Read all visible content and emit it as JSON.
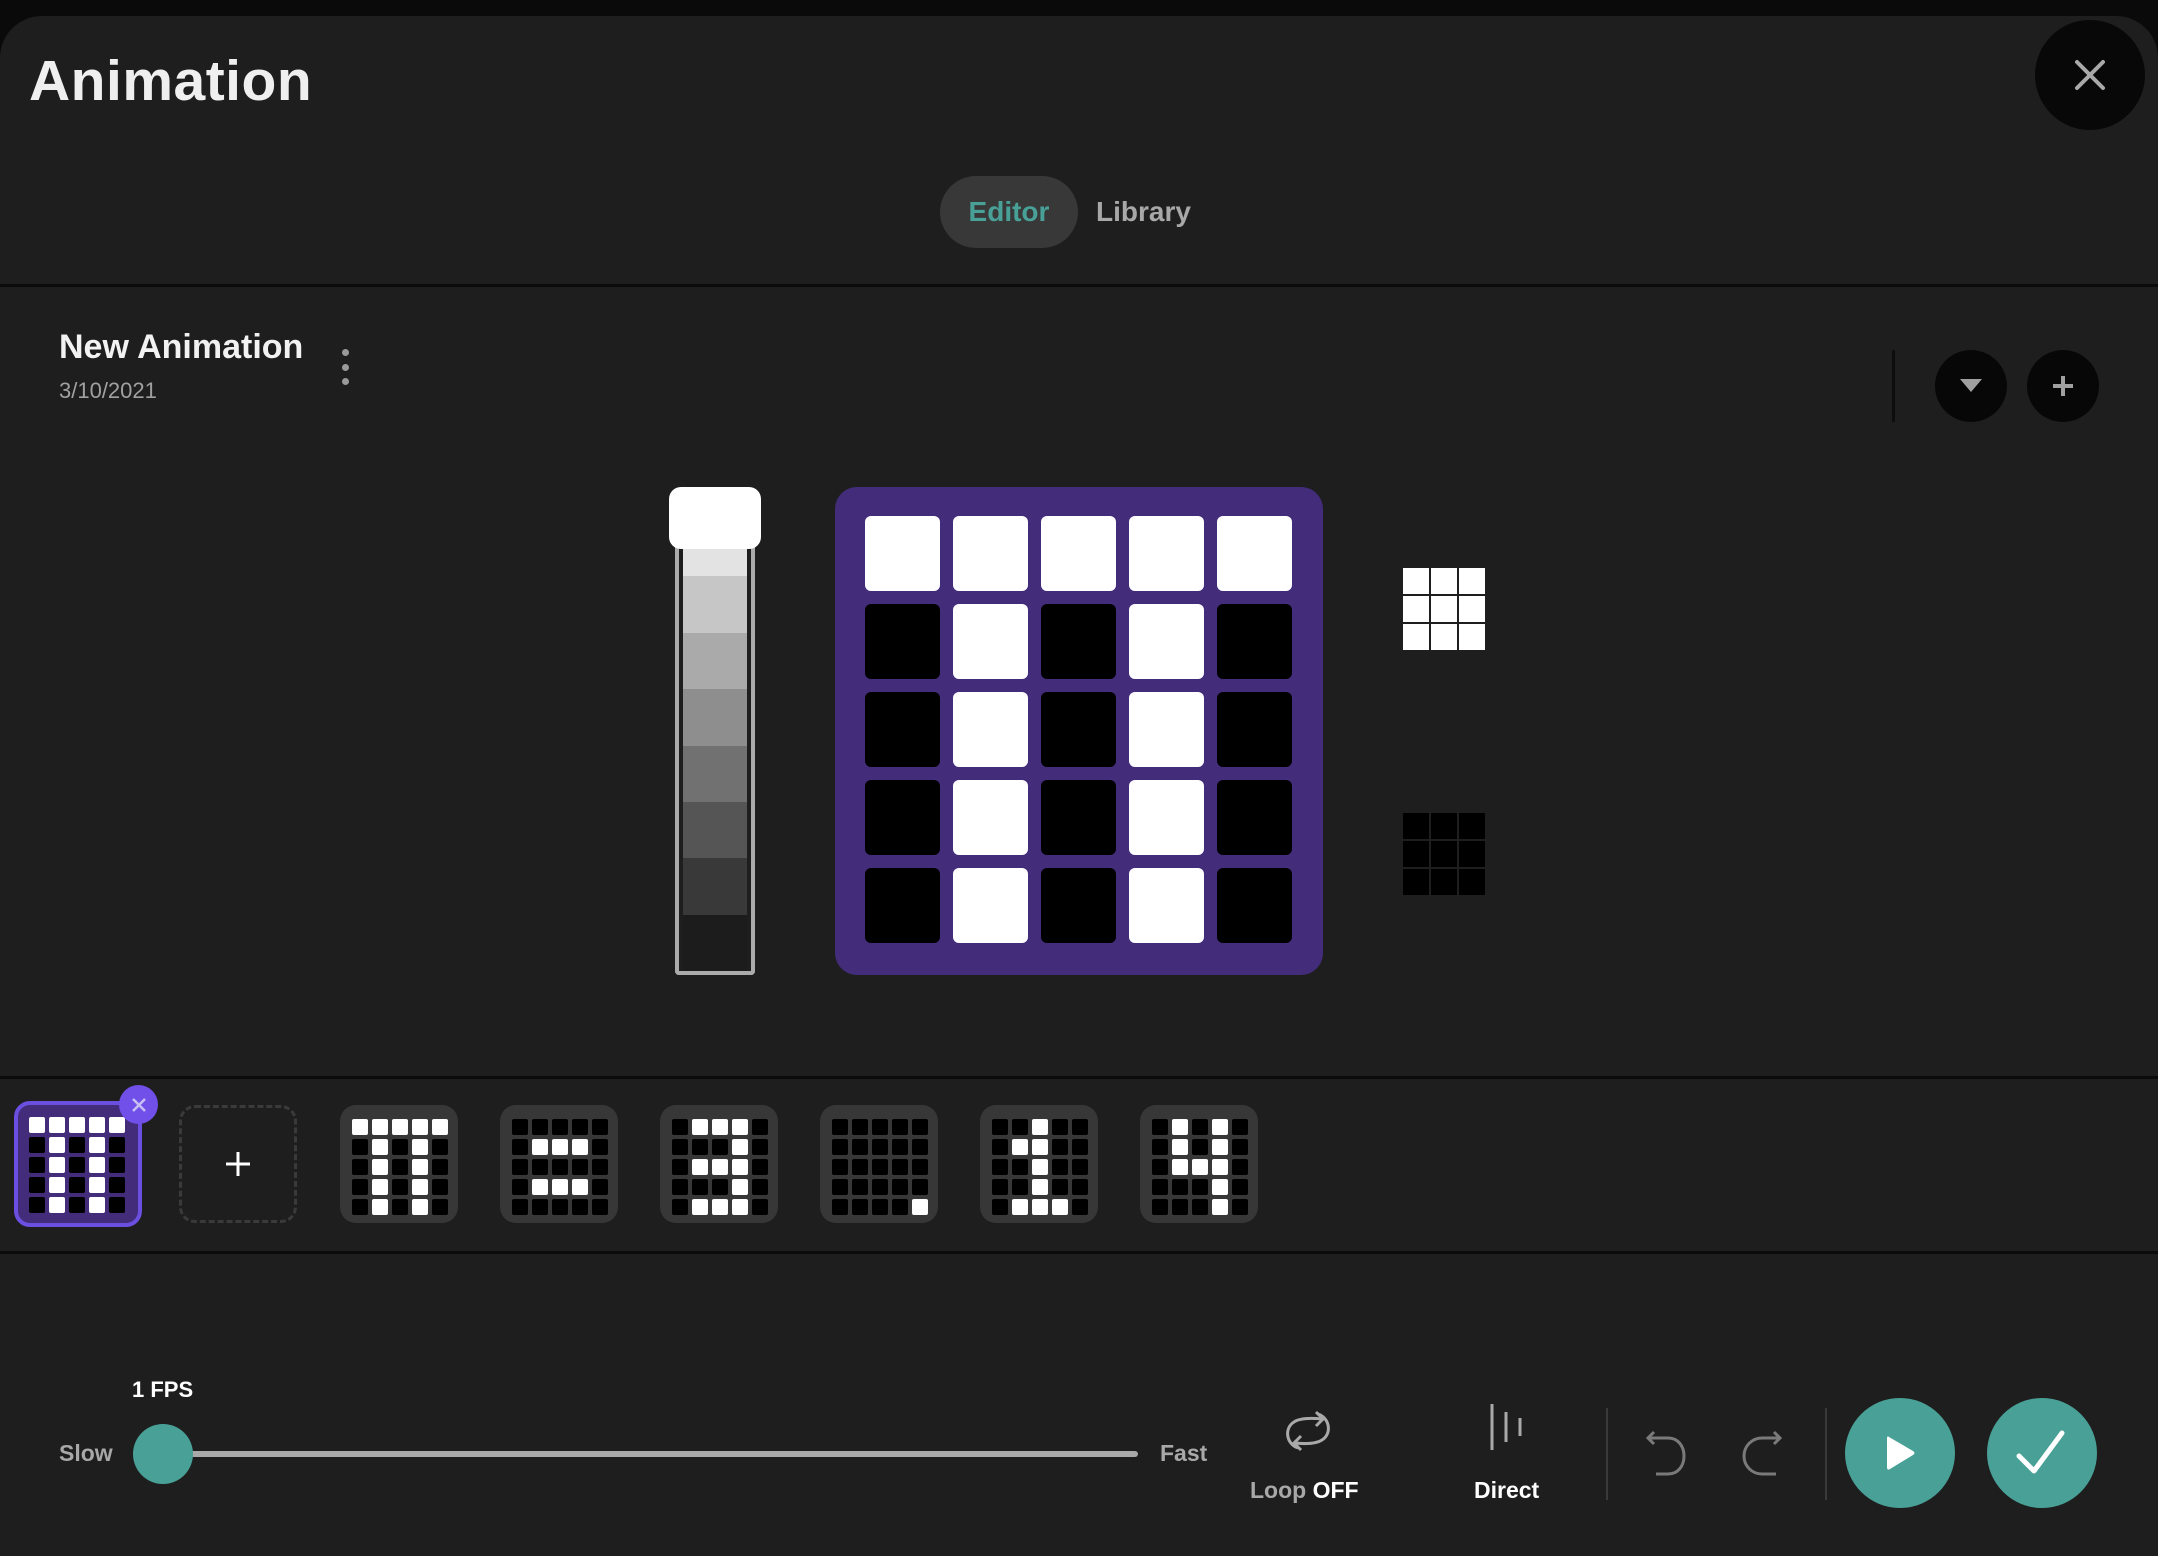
{
  "window": {
    "title": "Animation",
    "close_icon": "close-icon"
  },
  "tabs": [
    {
      "label": "Editor",
      "active": true
    },
    {
      "label": "Library",
      "active": false
    }
  ],
  "animation": {
    "name": "New Animation",
    "date": "3/10/2021",
    "menu_icon": "more-vertical-icon",
    "actions": {
      "dropdown_icon": "caret-down-icon",
      "add_icon": "plus-icon"
    }
  },
  "colors": {
    "accent_teal": "#48a097",
    "grid_purple": "#432d7a",
    "selected_border": "#6b4fe0",
    "delete_badge": "#7050e8",
    "on": "#ffffff",
    "off": "#000000"
  },
  "brightness": {
    "levels": [
      "#ffffff",
      "#e3e3e3",
      "#c6c6c6",
      "#aaaaaa",
      "#8e8e8e",
      "#717171",
      "#555555",
      "#393939",
      "#1c1c1c"
    ],
    "selected_index": 0
  },
  "editor_grid": [
    [
      1,
      1,
      1,
      1,
      1
    ],
    [
      0,
      1,
      0,
      1,
      0
    ],
    [
      0,
      1,
      0,
      1,
      0
    ],
    [
      0,
      1,
      0,
      1,
      0
    ],
    [
      0,
      1,
      0,
      1,
      0
    ]
  ],
  "fill_tools": [
    {
      "name": "fill-all-on",
      "color": "#ffffff"
    },
    {
      "name": "fill-all-off",
      "color": "#000000"
    }
  ],
  "frames": {
    "selected_index": 0,
    "add_label": "+",
    "delete_label": "×",
    "items": [
      [
        [
          1,
          1,
          1,
          1,
          1
        ],
        [
          0,
          1,
          0,
          1,
          0
        ],
        [
          0,
          1,
          0,
          1,
          0
        ],
        [
          0,
          1,
          0,
          1,
          0
        ],
        [
          0,
          1,
          0,
          1,
          0
        ]
      ],
      [
        [
          1,
          1,
          1,
          1,
          1
        ],
        [
          0,
          1,
          0,
          1,
          0
        ],
        [
          0,
          1,
          0,
          1,
          0
        ],
        [
          0,
          1,
          0,
          1,
          0
        ],
        [
          0,
          1,
          0,
          1,
          0
        ]
      ],
      [
        [
          0,
          0,
          0,
          0,
          0
        ],
        [
          0,
          1,
          1,
          1,
          0
        ],
        [
          0,
          0,
          0,
          0,
          0
        ],
        [
          0,
          1,
          1,
          1,
          0
        ],
        [
          0,
          0,
          0,
          0,
          0
        ]
      ],
      [
        [
          0,
          1,
          1,
          1,
          0
        ],
        [
          0,
          0,
          0,
          1,
          0
        ],
        [
          0,
          1,
          1,
          1,
          0
        ],
        [
          0,
          0,
          0,
          1,
          0
        ],
        [
          0,
          1,
          1,
          1,
          0
        ]
      ],
      [
        [
          0,
          0,
          0,
          0,
          0
        ],
        [
          0,
          0,
          0,
          0,
          0
        ],
        [
          0,
          0,
          0,
          0,
          0
        ],
        [
          0,
          0,
          0,
          0,
          0
        ],
        [
          0,
          0,
          0,
          0,
          1
        ]
      ],
      [
        [
          0,
          0,
          1,
          0,
          0
        ],
        [
          0,
          1,
          1,
          0,
          0
        ],
        [
          0,
          0,
          1,
          0,
          0
        ],
        [
          0,
          0,
          1,
          0,
          0
        ],
        [
          0,
          1,
          1,
          1,
          0
        ]
      ],
      [
        [
          0,
          1,
          0,
          1,
          0
        ],
        [
          0,
          1,
          0,
          1,
          0
        ],
        [
          0,
          1,
          1,
          1,
          0
        ],
        [
          0,
          0,
          0,
          1,
          0
        ],
        [
          0,
          0,
          0,
          1,
          0
        ]
      ]
    ]
  },
  "playback": {
    "fps_label": "1 FPS",
    "fps": 1,
    "speed_fraction": 0.0,
    "slow_label": "Slow",
    "fast_label": "Fast",
    "loop_label": "Loop",
    "loop_state": "OFF",
    "direction_label": "Direct",
    "undo_icon": "undo-icon",
    "redo_icon": "redo-icon",
    "play_icon": "play-icon",
    "confirm_icon": "check-icon"
  }
}
